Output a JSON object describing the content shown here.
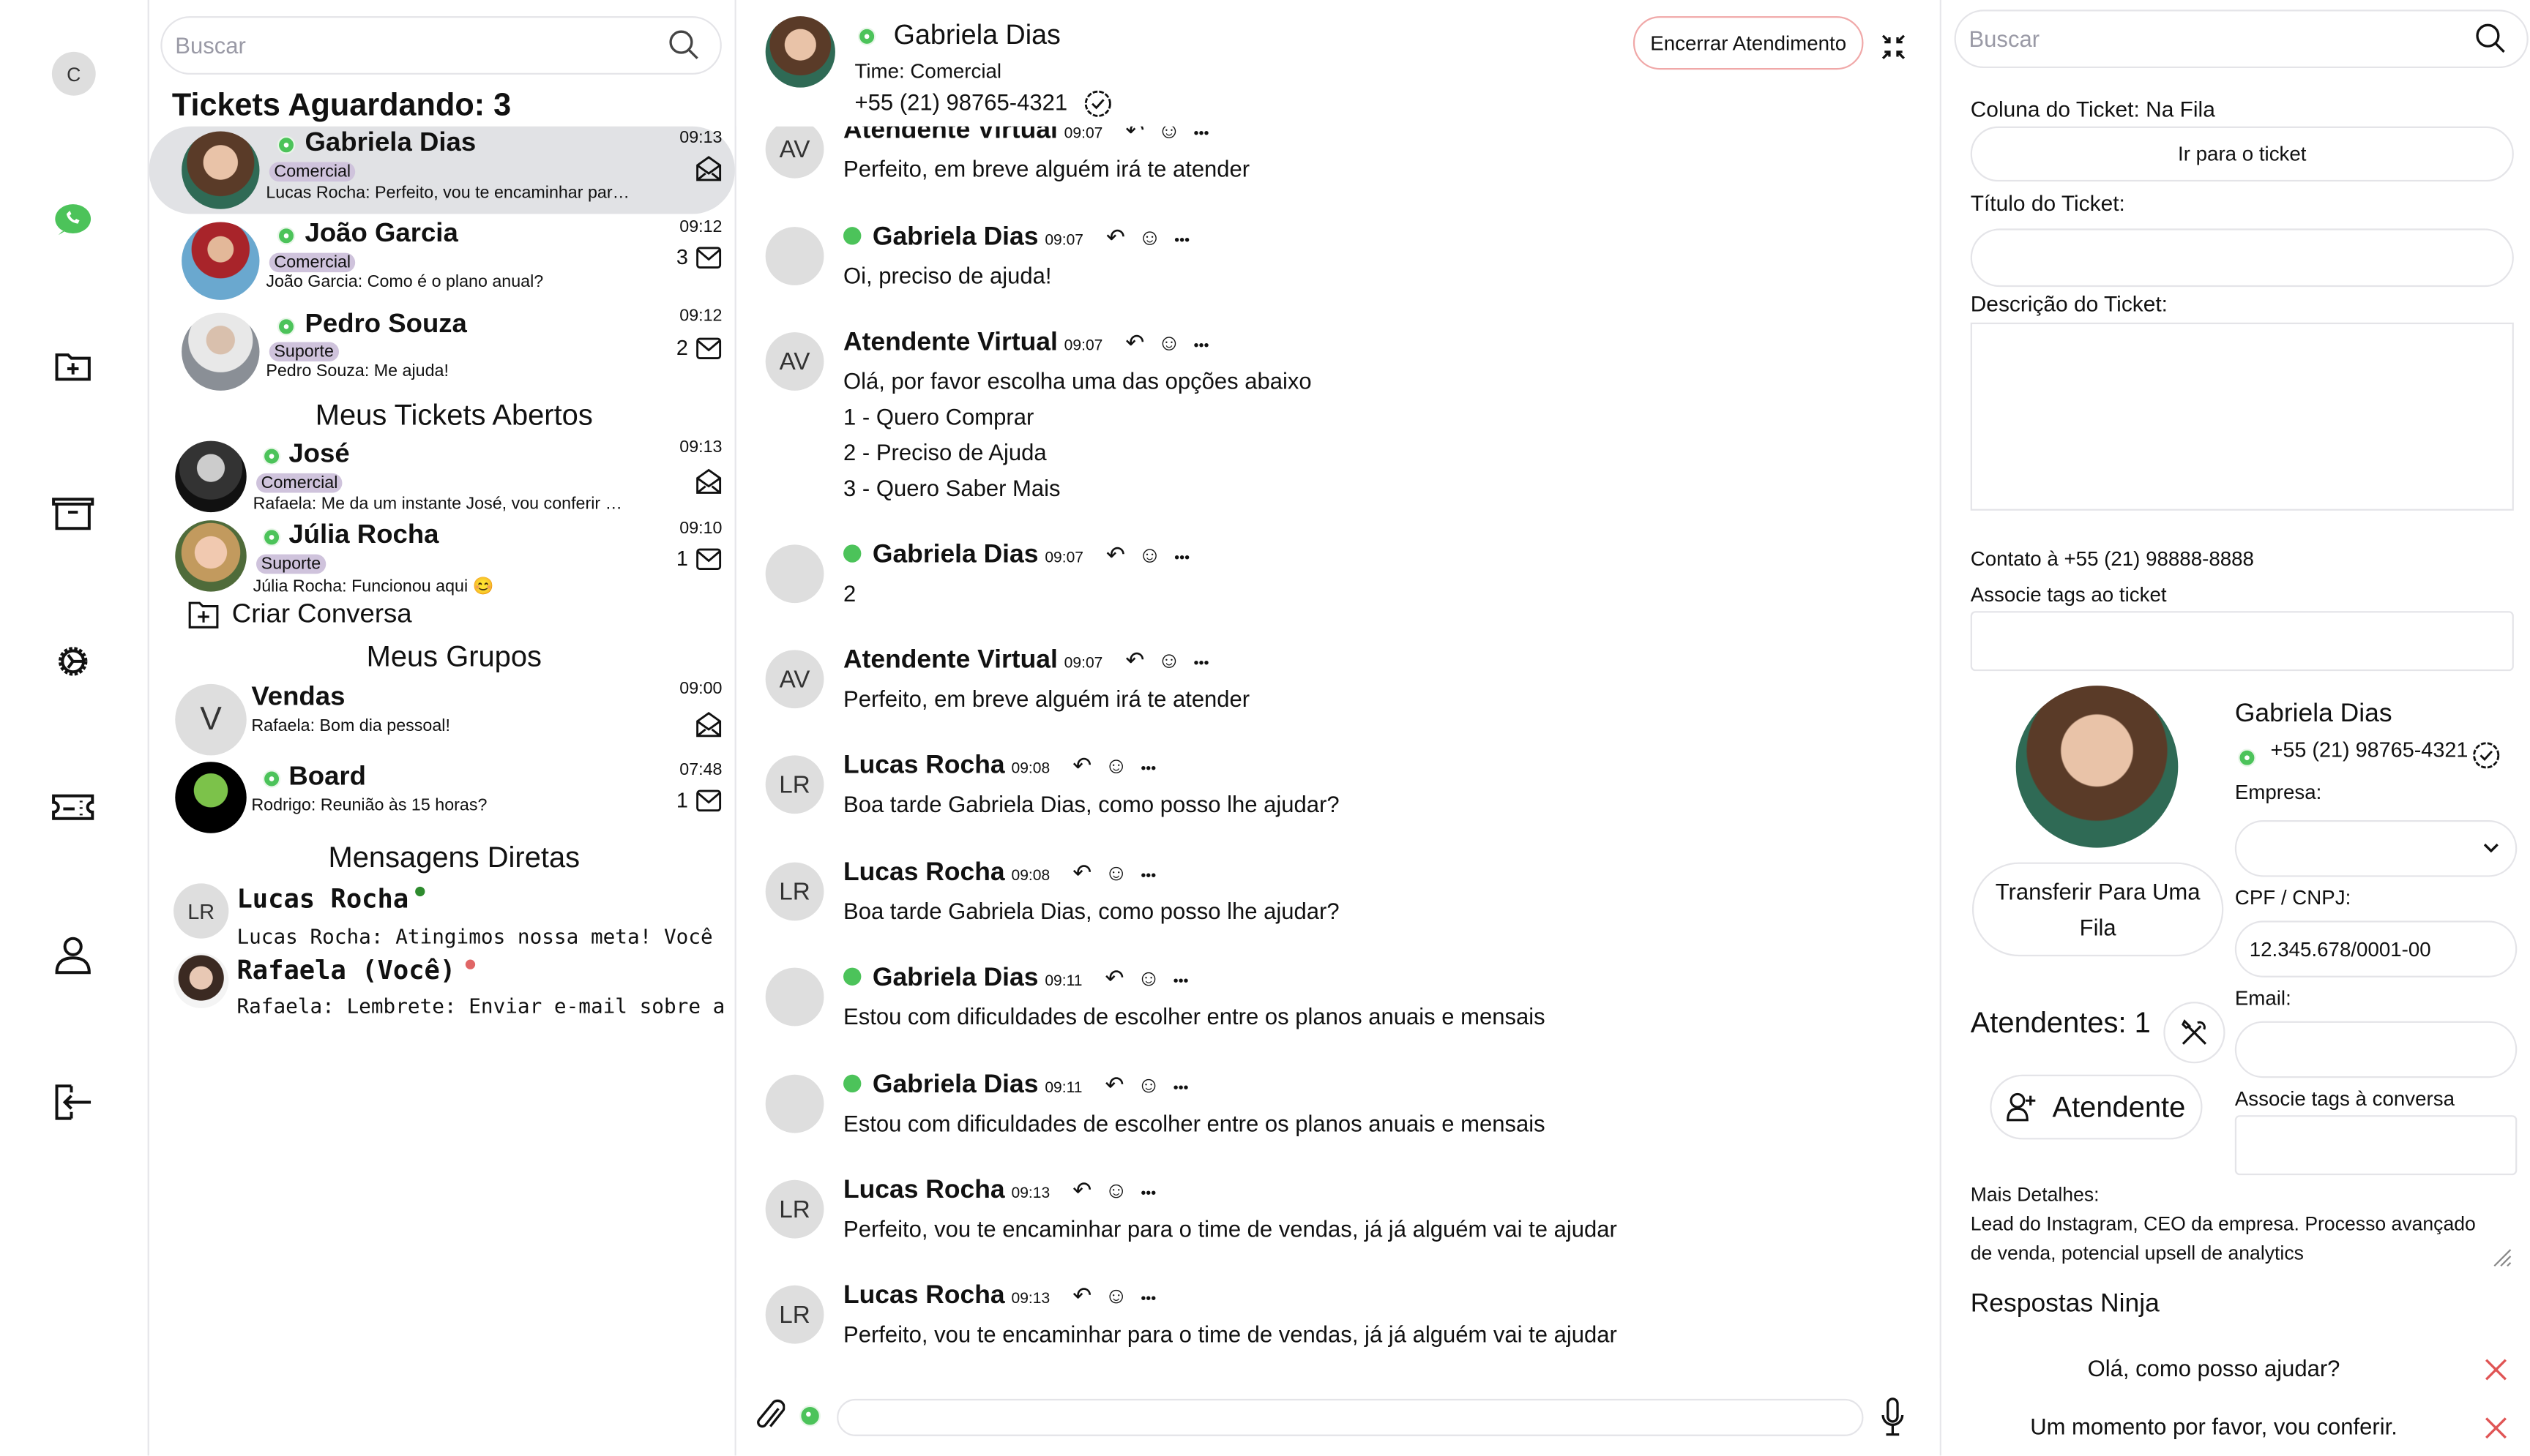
{
  "nav": {
    "avatar_letter": "C",
    "items": [
      "whatsapp-icon",
      "folder-plus-icon",
      "archive-icon",
      "gear-icon",
      "ticket-icon",
      "user-icon",
      "logout-icon"
    ]
  },
  "left": {
    "search_placeholder": "Buscar",
    "waiting_title": "Tickets Aguardando: 3",
    "waiting": [
      {
        "name": "Gabriela Dias",
        "tag": "Comercial",
        "preview": "Lucas Rocha: Perfeito, vou te encaminhar par…",
        "time": "09:13",
        "count": ""
      },
      {
        "name": "João Garcia",
        "tag": "Comercial",
        "preview": "João Garcia: Como é o plano anual?",
        "time": "09:12",
        "count": "3"
      },
      {
        "name": "Pedro Souza",
        "tag": "Suporte",
        "preview": "Pedro Souza: Me ajuda!",
        "time": "09:12",
        "count": "2"
      }
    ],
    "open_title": "Meus Tickets Abertos",
    "open": [
      {
        "name": "José",
        "tag": "Comercial",
        "preview": "Rafaela: Me da um instante José, vou conferir …",
        "time": "09:13",
        "count": ""
      },
      {
        "name": "Júlia Rocha",
        "tag": "Suporte",
        "preview": "Júlia Rocha: Funcionou aqui 😊",
        "time": "09:10",
        "count": "1"
      }
    ],
    "create_label": "Criar Conversa",
    "groups_title": "Meus Grupos",
    "groups": [
      {
        "name": "Vendas",
        "initial": "V",
        "preview": "Rafaela: Bom dia pessoal!",
        "time": "09:00",
        "count": ""
      },
      {
        "name": "Board",
        "preview": "Rodrigo: Reunião às 15 horas?",
        "time": "07:48",
        "count": "1"
      }
    ],
    "direct_title": "Mensagens Diretas",
    "direct": [
      {
        "name": "Lucas Rocha",
        "initials": "LR",
        "preview": "Lucas Rocha: Atingimos nossa meta! Você",
        "status_color": "#2e8b2e"
      },
      {
        "name": "Rafaela (Você)",
        "preview": "Rafaela: Lembrete: Enviar e-mail sobre a",
        "status_color": "#e06666"
      }
    ]
  },
  "chat": {
    "contact_name": "Gabriela Dias",
    "team": "Time: Comercial",
    "phone": "+55 (21) 98765-4321",
    "end_button": "Encerrar Atendimento",
    "messages": [
      {
        "sender": "Atendente Virtual",
        "time": "09:07",
        "av": "AV",
        "wa": false,
        "lines": [
          "Perfeito, em breve alguém irá te atender"
        ]
      },
      {
        "sender": "Gabriela Dias",
        "time": "09:07",
        "av": "photo",
        "wa": true,
        "lines": [
          "Oi, preciso de ajuda!"
        ]
      },
      {
        "sender": "Atendente Virtual",
        "time": "09:07",
        "av": "AV",
        "wa": false,
        "lines": [
          "Olá, por favor escolha uma das opções abaixo",
          "1 - Quero Comprar",
          "2 - Preciso de Ajuda",
          "3 - Quero Saber Mais"
        ]
      },
      {
        "sender": "Gabriela Dias",
        "time": "09:07",
        "av": "photo",
        "wa": true,
        "lines": [
          "2"
        ]
      },
      {
        "sender": "Atendente Virtual",
        "time": "09:07",
        "av": "AV",
        "wa": false,
        "lines": [
          "Perfeito, em breve alguém irá te atender"
        ]
      },
      {
        "sender": "Lucas Rocha",
        "time": "09:08",
        "av": "LR",
        "wa": false,
        "lines": [
          "Boa tarde Gabriela Dias, como posso lhe ajudar?"
        ]
      },
      {
        "sender": "Lucas Rocha",
        "time": "09:08",
        "av": "LR",
        "wa": false,
        "lines": [
          "Boa tarde Gabriela Dias, como posso lhe ajudar?"
        ]
      },
      {
        "sender": "Gabriela Dias",
        "time": "09:11",
        "av": "photo",
        "wa": true,
        "lines": [
          "Estou com dificuldades de escolher entre os planos anuais e mensais"
        ]
      },
      {
        "sender": "Gabriela Dias",
        "time": "09:11",
        "av": "photo",
        "wa": true,
        "lines": [
          "Estou com dificuldades de escolher entre os planos anuais e mensais"
        ]
      },
      {
        "sender": "Lucas Rocha",
        "time": "09:13",
        "av": "LR",
        "wa": false,
        "lines": [
          "Perfeito, vou te encaminhar para o time de vendas, já já alguém vai te ajudar"
        ]
      },
      {
        "sender": "Lucas Rocha",
        "time": "09:13",
        "av": "LR",
        "wa": false,
        "lines": [
          "Perfeito, vou te encaminhar para o time de vendas, já já alguém vai te ajudar"
        ]
      }
    ],
    "input_value": ""
  },
  "right": {
    "search_placeholder": "Buscar",
    "ticket_column": "Coluna do Ticket: Na Fila",
    "goto_ticket": "Ir para o ticket",
    "title_label": "Título do Ticket:",
    "title_value": "",
    "desc_label": "Descrição do Ticket:",
    "desc_value": "",
    "contact_at": "Contato à +55 (21) 98888-8888",
    "ticket_tags_label": "Associe tags ao ticket",
    "contact_name": "Gabriela Dias",
    "contact_phone": "+55 (21) 98765-4321",
    "company_label": "Empresa:",
    "company_value": "",
    "cpf_label": "CPF / CNPJ:",
    "cpf_value": "12.345.678/0001-00",
    "email_label": "Email:",
    "email_value": "",
    "conv_tags_label": "Associe tags à conversa",
    "transfer_button": [
      "Transferir Para Uma",
      "Fila"
    ],
    "attendants_label": "Atendentes: 1",
    "add_attendant": "Atendente",
    "details_label": "Mais Detalhes:",
    "details_lines": [
      "Lead do Instagram, CEO da empresa. Processo avançado",
      "de venda, potencial upsell de analytics"
    ],
    "ninja_title": "Respostas Ninja",
    "ninja": [
      "Olá, como posso ajudar?",
      "Um momento por favor, vou conferir."
    ]
  },
  "colors": {
    "accent_tag": "#cfc3dc",
    "selected_bg": "#e1e2e5",
    "whatsapp": "#4cc35a",
    "danger": "#e05555",
    "end_border": "#f0a8a8"
  }
}
